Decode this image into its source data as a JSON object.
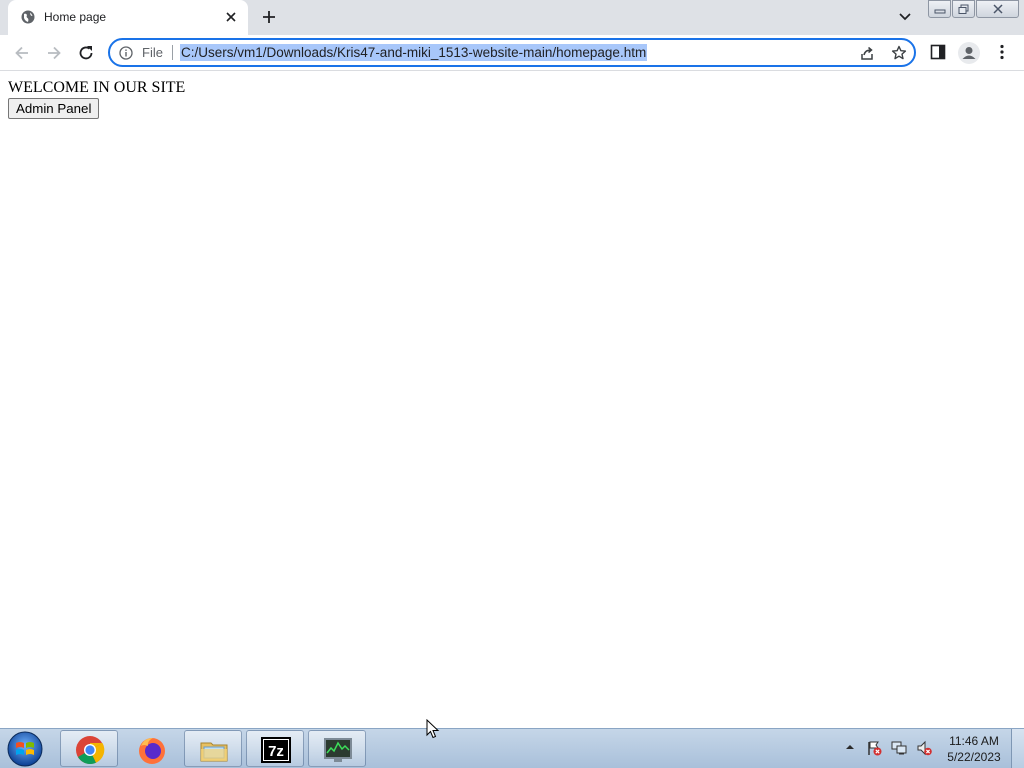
{
  "browser": {
    "tab": {
      "title": "Home page"
    },
    "toolbar": {
      "scheme_label": "File",
      "url": "C:/Users/vm1/Downloads/Kris47-and-miki_1513-website-main/homepage.htm"
    }
  },
  "page": {
    "heading": "WELCOME IN OUR SITE",
    "admin_button": "Admin Panel"
  },
  "taskbar": {
    "apps": [
      "chrome-icon",
      "firefox-icon",
      "file-explorer-icon",
      "7zip-icon",
      "task-manager-icon"
    ],
    "clock": {
      "time": "11:46 AM",
      "date": "5/22/2023"
    }
  },
  "colors": {
    "accent": "#1a73e8",
    "url_selection": "#a8c7fa",
    "tabstrip": "#dee1e6"
  }
}
